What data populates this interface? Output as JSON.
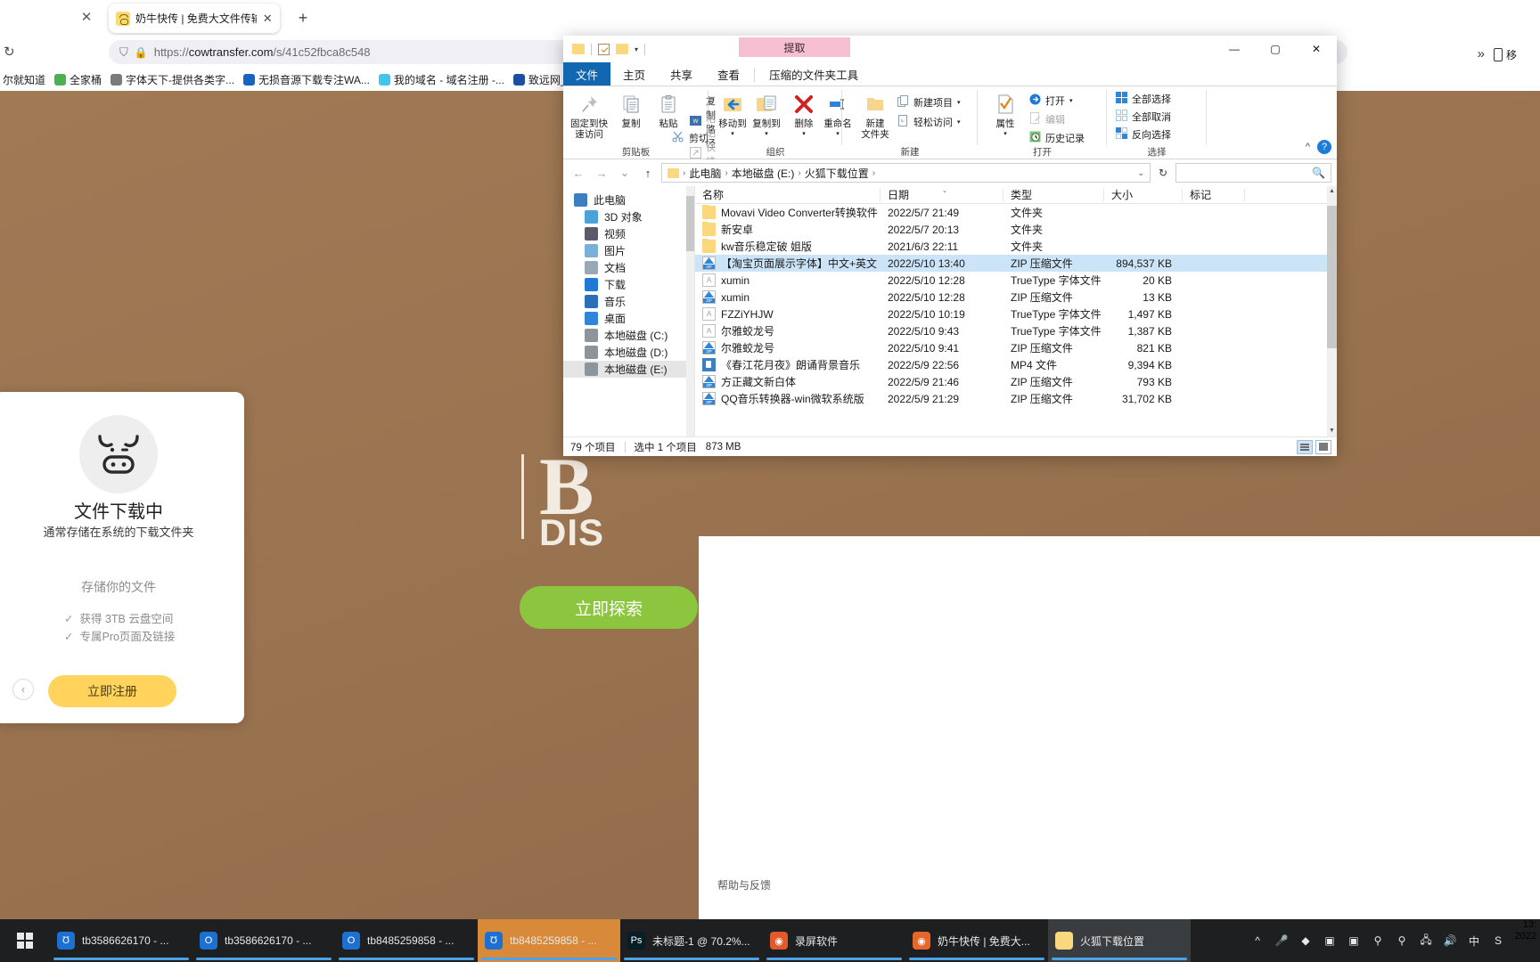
{
  "browser": {
    "tab": {
      "title": "奶牛快传 | 免费大文件传输工具",
      "close": "✕",
      "newtab": "+",
      "left_close": "✕"
    },
    "url": {
      "scheme": "https://",
      "host": "cowtransfer.com",
      "path": "/s/41c52fbca8c548",
      "shield": "⛉",
      "lock": "🔒"
    },
    "bookmarks": [
      {
        "label": "尔就知道",
        "color": "#ffffff"
      },
      {
        "label": "全家桶",
        "color": "#4caf50"
      },
      {
        "label": "字体天下-提供各类字...",
        "color": "#7b7b7b"
      },
      {
        "label": "无损音源下载专注WA...",
        "color": "#1565c0"
      },
      {
        "label": "我的域名 - 域名注册 -...",
        "color": "#3fc6e8"
      },
      {
        "label": "致远网_免费",
        "color": "#1d4ea2"
      }
    ],
    "overflow_chevron": "»",
    "mobile_label": "移",
    "collapse_caret": "^",
    "help_badge": "?"
  },
  "page": {
    "hero_letter": "B",
    "hero_sub": "DIS",
    "cta_label": "立即探索",
    "card": {
      "title": "文件下载中",
      "subtitle": "通常存储在系统的下载文件夹",
      "section": "存储你的文件",
      "features": [
        "获得 3TB 云盘空间",
        "专属Pro页面及链接"
      ],
      "check": "✓",
      "signup_label": "立即注册",
      "back_arrow": "‹"
    },
    "help_feedback": "帮助与反馈"
  },
  "explorer": {
    "title": "火狐下载位置",
    "contextual_tab": "提取",
    "quick_access": {
      "folder": "folder-icon",
      "check": "checkbox-icon",
      "caret": "▾"
    },
    "window_buttons": {
      "minimize": "—",
      "maximize": "▢",
      "close": "✕"
    },
    "tabs": [
      {
        "label": "文件",
        "kind": "file"
      },
      {
        "label": "主页",
        "kind": "active"
      },
      {
        "label": "共享",
        "kind": "normal"
      },
      {
        "label": "查看",
        "kind": "normal"
      },
      {
        "label": "压缩的文件夹工具",
        "kind": "contextual"
      }
    ],
    "ribbon": {
      "groups": [
        {
          "label": "剪贴板",
          "big": [
            {
              "label": "固定到快\n速访问",
              "icon": "pin-icon"
            },
            {
              "label": "复制",
              "icon": "copy-icon"
            },
            {
              "label": "粘贴",
              "icon": "paste-icon"
            }
          ],
          "small": [
            {
              "label": "复制路径",
              "icon": "copy-path-icon",
              "disabled": false
            },
            {
              "label": "粘贴快捷方式",
              "icon": "paste-shortcut-icon",
              "disabled": true
            },
            {
              "label": "剪切",
              "icon": "scissors-icon",
              "disabled": false
            }
          ]
        },
        {
          "label": "组织",
          "big": [
            {
              "label": "移动到",
              "icon": "move-to-icon"
            },
            {
              "label": "复制到",
              "icon": "copy-to-icon"
            },
            {
              "label": "删除",
              "icon": "delete-icon"
            },
            {
              "label": "重命名",
              "icon": "rename-icon"
            }
          ],
          "small": []
        },
        {
          "label": "新建",
          "big": [
            {
              "label": "新建\n文件夹",
              "icon": "new-folder-icon"
            }
          ],
          "small": [
            {
              "label": "新建项目",
              "icon": "new-item-icon",
              "disabled": false
            },
            {
              "label": "轻松访问",
              "icon": "easy-access-icon",
              "disabled": false
            }
          ]
        },
        {
          "label": "打开",
          "big": [
            {
              "label": "属性",
              "icon": "properties-icon"
            }
          ],
          "small": [
            {
              "label": "打开",
              "icon": "open-icon",
              "disabled": false
            },
            {
              "label": "编辑",
              "icon": "edit-icon",
              "disabled": true
            },
            {
              "label": "历史记录",
              "icon": "history-icon",
              "disabled": false
            }
          ]
        },
        {
          "label": "选择",
          "big": [],
          "small": [
            {
              "label": "全部选择",
              "icon": "select-all-icon",
              "disabled": false
            },
            {
              "label": "全部取消",
              "icon": "select-none-icon",
              "disabled": false
            },
            {
              "label": "反向选择",
              "icon": "invert-selection-icon",
              "disabled": false
            }
          ]
        }
      ]
    },
    "address": {
      "back": "←",
      "forward": "→",
      "recent": "⌄",
      "up": "↑",
      "crumbs": [
        "此电脑",
        "本地磁盘 (E:)",
        "火狐下载位置"
      ],
      "crumb_sep": "›",
      "dropdown": "⌄",
      "refresh": "↻",
      "search_placeholder": "",
      "search_icon": "search-icon"
    },
    "nav_pane": [
      {
        "label": "此电脑",
        "icon": "this-pc-icon",
        "level": 0
      },
      {
        "label": "3D 对象",
        "icon": "3d-objects-icon",
        "level": 1
      },
      {
        "label": "视频",
        "icon": "videos-icon",
        "level": 1
      },
      {
        "label": "图片",
        "icon": "pictures-icon",
        "level": 1
      },
      {
        "label": "文档",
        "icon": "documents-icon",
        "level": 1
      },
      {
        "label": "下载",
        "icon": "downloads-icon",
        "level": 1
      },
      {
        "label": "音乐",
        "icon": "music-icon",
        "level": 1
      },
      {
        "label": "桌面",
        "icon": "desktop-icon",
        "level": 1
      },
      {
        "label": "本地磁盘 (C:)",
        "icon": "drive-icon",
        "level": 1
      },
      {
        "label": "本地磁盘 (D:)",
        "icon": "drive-icon",
        "level": 1
      },
      {
        "label": "本地磁盘 (E:)",
        "icon": "drive-icon",
        "level": 1,
        "selected": true
      }
    ],
    "columns": [
      "名称",
      "日期",
      "类型",
      "大小",
      "标记"
    ],
    "sorted_column": "日期",
    "sort_marker": "⌄",
    "files": [
      {
        "name": "Movavi Video Converter转换软件",
        "date": "2022/5/7 21:49",
        "type": "文件夹",
        "size": "",
        "icon": "folder-icon"
      },
      {
        "name": "新安卓",
        "date": "2022/5/7 20:13",
        "type": "文件夹",
        "size": "",
        "icon": "folder-icon"
      },
      {
        "name": "kw音乐稳定破 姐版",
        "date": "2021/6/3 22:11",
        "type": "文件夹",
        "size": "",
        "icon": "folder-icon"
      },
      {
        "name": "【淘宝页面展示字体】中文+英文",
        "date": "2022/5/10 13:40",
        "type": "ZIP 压缩文件",
        "size": "894,537 KB",
        "icon": "zip-icon",
        "selected": true
      },
      {
        "name": "xumin",
        "date": "2022/5/10 12:28",
        "type": "TrueType 字体文件",
        "size": "20 KB",
        "icon": "ttf-icon"
      },
      {
        "name": "xumin",
        "date": "2022/5/10 12:28",
        "type": "ZIP 压缩文件",
        "size": "13 KB",
        "icon": "zip-icon"
      },
      {
        "name": "FZZiYHJW",
        "date": "2022/5/10 10:19",
        "type": "TrueType 字体文件",
        "size": "1,497 KB",
        "icon": "ttf-icon"
      },
      {
        "name": "尔雅蛟龙号",
        "date": "2022/5/10 9:43",
        "type": "TrueType 字体文件",
        "size": "1,387 KB",
        "icon": "ttf-icon"
      },
      {
        "name": "尔雅蛟龙号",
        "date": "2022/5/10 9:41",
        "type": "ZIP 压缩文件",
        "size": "821 KB",
        "icon": "zip-icon"
      },
      {
        "name": "《春江花月夜》朗诵背景音乐",
        "date": "2022/5/9 22:56",
        "type": "MP4 文件",
        "size": "9,394 KB",
        "icon": "mp4-icon"
      },
      {
        "name": "方正藏文新白体",
        "date": "2022/5/9 21:46",
        "type": "ZIP 压缩文件",
        "size": "793 KB",
        "icon": "zip-icon"
      },
      {
        "name": "QQ音乐转换器-win微软系统版",
        "date": "2022/5/9 21:29",
        "type": "ZIP 压缩文件",
        "size": "31,702 KB",
        "icon": "zip-icon"
      }
    ],
    "status": {
      "items": "79 个项目",
      "selected": "选中 1 个项目",
      "size": "873 MB"
    },
    "view_buttons": {
      "details": "details-view-icon",
      "thumbnails": "thumbnail-view-icon"
    }
  },
  "taskbar": {
    "start": "start-icon",
    "items": [
      {
        "label": "tb3586626170 - ...",
        "icon": "browser-icon",
        "color": "#1d6fd0",
        "glyph": "Ʊ",
        "state": "open"
      },
      {
        "label": "tb3586626170 - ...",
        "icon": "browser-icon",
        "color": "#1d6fd0",
        "glyph": "O",
        "state": "open"
      },
      {
        "label": "tb8485259858 - ...",
        "icon": "browser-icon",
        "color": "#1d6fd0",
        "glyph": "O",
        "state": "open"
      },
      {
        "label": "tb8485259858 - ...",
        "icon": "browser-icon",
        "color": "#1d6fd0",
        "glyph": "Ʊ",
        "state": "active"
      },
      {
        "label": "未标题-1 @ 70.2%...",
        "icon": "photoshop-icon",
        "color": "#061e26",
        "glyph": "Ps",
        "state": "open"
      },
      {
        "label": "录屏软件",
        "icon": "screen-recorder-icon",
        "color": "#e05a2b",
        "glyph": "◉",
        "state": "open"
      },
      {
        "label": "奶牛快传 | 免费大...",
        "icon": "firefox-icon",
        "color": "#e6662b",
        "glyph": "◉",
        "state": "open"
      },
      {
        "label": "火狐下载位置",
        "icon": "explorer-icon",
        "color": "#fbd77e",
        "glyph": "",
        "state": "active2"
      }
    ],
    "tray": [
      {
        "name": "show-hidden-icons",
        "glyph": "^"
      },
      {
        "name": "microphone-icon",
        "glyph": "🎤"
      },
      {
        "name": "cloud-drive-icon",
        "glyph": "◆"
      },
      {
        "name": "app-green-icon",
        "glyph": "▣"
      },
      {
        "name": "app-green-2-icon",
        "glyph": "▣"
      },
      {
        "name": "red-pin-icon",
        "glyph": "⚲"
      },
      {
        "name": "red-pin-2-icon",
        "glyph": "⚲"
      },
      {
        "name": "network-icon",
        "glyph": "🖧"
      },
      {
        "name": "volume-icon",
        "glyph": "🔊"
      },
      {
        "name": "ime-icon",
        "glyph": "中"
      },
      {
        "name": "sogou-icon",
        "glyph": "S"
      }
    ],
    "clock": {
      "time": "13:",
      "date": "2022"
    }
  }
}
